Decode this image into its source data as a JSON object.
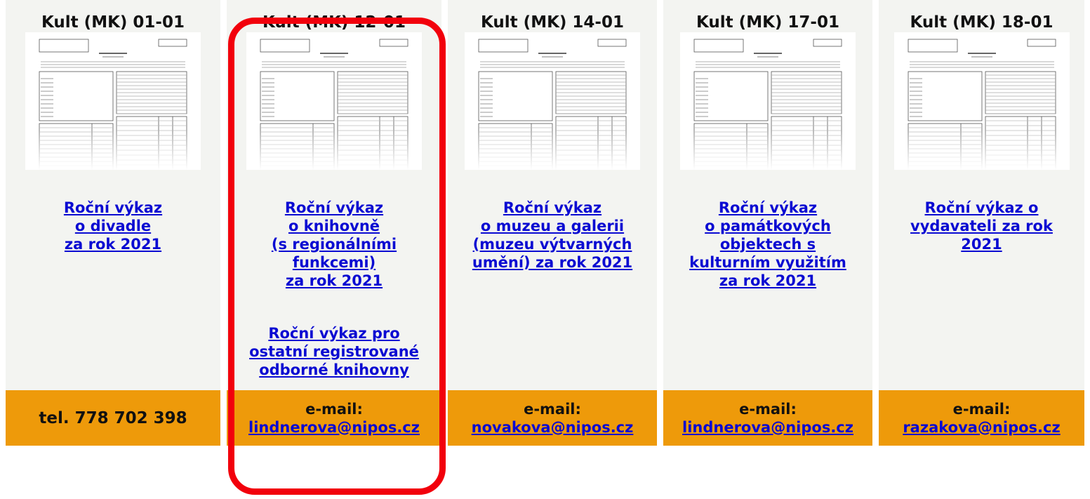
{
  "columns": [
    {
      "header": "Kult (MK) 01-01",
      "description_lines": [
        "Roční výkaz",
        "o divadle",
        "za rok 2021"
      ],
      "footer_text": "tel. 778 702 398"
    },
    {
      "header": "Kult (MK) 12-01",
      "description_lines": [
        "Roční výkaz",
        "o knihovně",
        "(s regionálními",
        "funkcemi)",
        "za rok 2021"
      ],
      "extra_lines": [
        "Roční výkaz pro",
        "ostatní registrované",
        "odborné knihovny"
      ],
      "footer_label": "e-mail:",
      "footer_email": "lindnerova@nipos.cz"
    },
    {
      "header": "Kult (MK) 14-01",
      "description_lines": [
        "Roční výkaz",
        "o muzeu a galerii",
        "(muzeu výtvarných",
        "umění) za rok 2021"
      ],
      "footer_label": "e-mail:",
      "footer_email": "novakova@nipos.cz"
    },
    {
      "header": "Kult (MK) 17-01",
      "description_lines": [
        "Roční výkaz",
        "o památkových",
        "objektech s",
        "kulturním využitím",
        "za rok 2021"
      ],
      "footer_label": "e-mail:",
      "footer_email": "lindnerova@nipos.cz"
    },
    {
      "header": "Kult (MK) 18-01",
      "description_lines": [
        "Roční výkaz o",
        "vydavateli za rok",
        "2021"
      ],
      "footer_label": "e-mail:",
      "footer_email": "razakova@nipos.cz"
    }
  ],
  "colors": {
    "column_background": "#f3f4f1",
    "footer_background": "#ee9a0a",
    "link": "#0a0ad2",
    "highlight_border": "#f2000c"
  },
  "icons": {
    "thumbnail": "form-preview-thumbnail-icon"
  }
}
